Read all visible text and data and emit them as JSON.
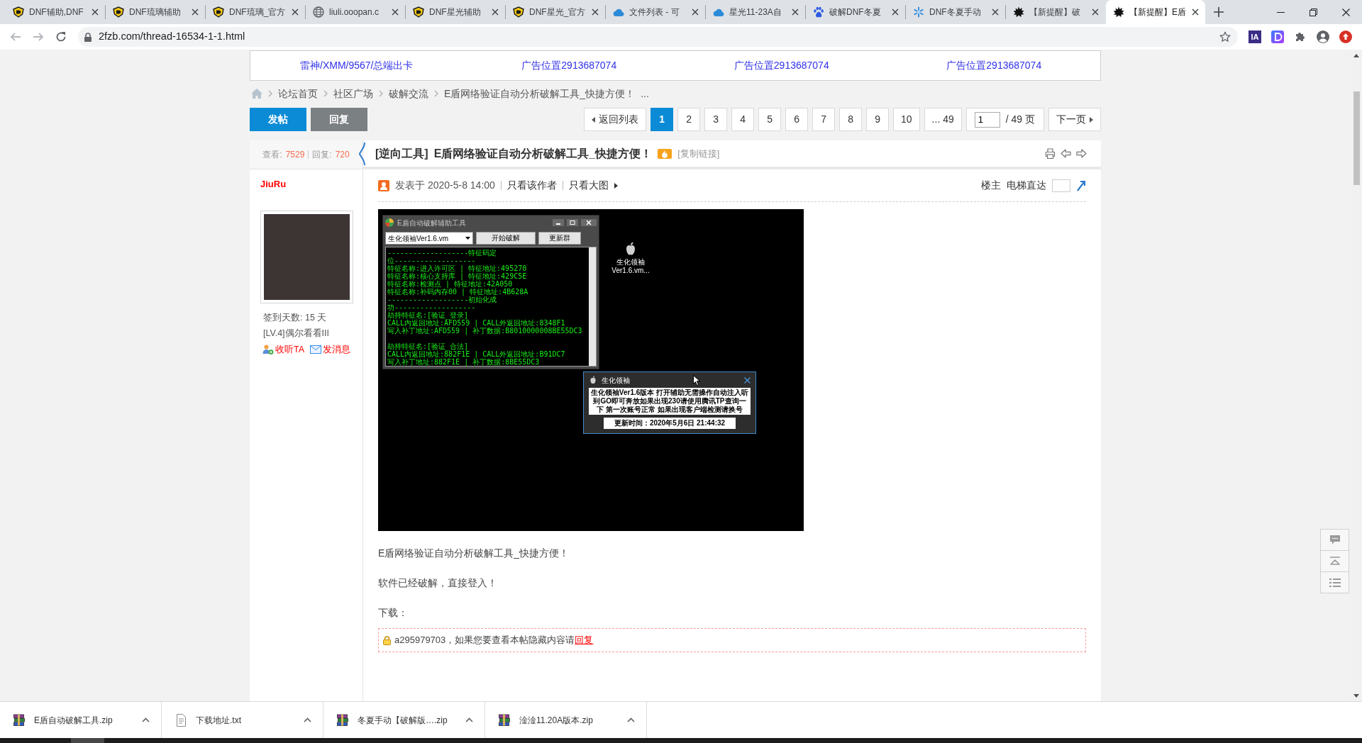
{
  "browser": {
    "tabs": [
      {
        "title": "DNF辅助,DNF",
        "kind": "crest",
        "selected": false
      },
      {
        "title": "DNF琉璃辅助",
        "kind": "crest",
        "selected": false
      },
      {
        "title": "DNF琉璃_官方",
        "kind": "crest",
        "selected": false
      },
      {
        "title": "liuli.ooopan.c",
        "kind": "globe",
        "selected": false
      },
      {
        "title": "DNF星光辅助",
        "kind": "crest",
        "selected": false
      },
      {
        "title": "DNF星光_官方",
        "kind": "crest",
        "selected": false
      },
      {
        "title": "文件列表 - 可",
        "kind": "cloud",
        "selected": false
      },
      {
        "title": "星光11-23A自",
        "kind": "cloud",
        "selected": false
      },
      {
        "title": "破解DNF冬夏",
        "kind": "paw",
        "selected": false
      },
      {
        "title": "DNF冬夏手动",
        "kind": "snowflake",
        "selected": false
      },
      {
        "title": "【新提醒】破",
        "kind": "splat",
        "selected": false
      },
      {
        "title": "【新提醒】E盾",
        "kind": "splat",
        "selected": true
      }
    ],
    "url": "2fzb.com/thread-16534-1-1.html",
    "extensions": [
      {
        "kind": "badge",
        "label": "IA"
      },
      {
        "kind": "tile"
      },
      {
        "kind": "puzzle"
      },
      {
        "kind": "account"
      },
      {
        "kind": "update"
      }
    ]
  },
  "forum": {
    "ad_links": [
      "雷神/XMM/9567/总端出卡",
      "广告位置2913687074",
      "广告位置2913687074",
      "广告位置2913687074"
    ],
    "breadcrumb": {
      "links": [
        "论坛首页",
        "社区广场",
        "破解交流",
        "E盾网络验证自动分析破解工具_快捷方便！"
      ],
      "more": "..."
    },
    "actions": [
      {
        "label": "发帖",
        "kind": "primary"
      },
      {
        "label": "回复",
        "kind": "secondary"
      }
    ],
    "pagination": {
      "back": "返回列表",
      "pages": [
        {
          "label": "1",
          "selected": true
        },
        {
          "label": "2",
          "selected": false
        },
        {
          "label": "3",
          "selected": false
        },
        {
          "label": "4",
          "selected": false
        },
        {
          "label": "5",
          "selected": false
        },
        {
          "label": "6",
          "selected": false
        },
        {
          "label": "7",
          "selected": false
        },
        {
          "label": "8",
          "selected": false
        },
        {
          "label": "9",
          "selected": false
        },
        {
          "label": "10",
          "selected": false
        },
        {
          "label": "... 49",
          "selected": false
        }
      ],
      "page_input": "1",
      "page_total": "/ 49 页",
      "next": "下一页"
    },
    "thread": {
      "views_label": "查看:",
      "views": "7529",
      "replies_label": "回复:",
      "replies": "720",
      "category": "[逆向工具]",
      "title": "E盾网络验证自动分析破解工具_快捷方便！",
      "copy_link": "[复制链接]"
    },
    "author": {
      "name": "JiuRu",
      "checkin": "签到天数: 15 天",
      "level": "[LV.4]偶尔看看III",
      "follow": "收听TA",
      "message": "发消息"
    },
    "post": {
      "posted": "发表于 2020-5-8 14:00",
      "author_only": "只看该作者",
      "large_images": "只看大图",
      "floor": "楼主",
      "jump": "电梯直达",
      "screenshot": {
        "tool_window": {
          "title": "E盾自动破解辅助工具",
          "combo": "生化领袖Ver1.6.vm",
          "buttons": [
            "开始破解",
            "更新群"
          ],
          "console": [
            [
              "-------------------特征码定",
              "位-------------------",
              "特征名称:进入许可区 | 特征地址:495270",
              "特征名称:核心支持库 | 特征地址:429C5E",
              "特征名称:检测点 | 特征地址:42A050",
              "特征名称:补码内存00 | 特征地址:4B628A",
              "-------------------初始化成",
              "功-------------------",
              "劫持特征名:[验证_登录]",
              "CALL内返回地址:AFD559 | CALL外返回地址:8348F1",
              "写入补丁地址:AFD559 | 补丁数据:B8010000008BE55DC3"
            ],
            [
              "劫持特征名:[验证_合法]",
              "CALL内返回地址:882F1E | CALL外返回地址:B91DC7",
              "写入补丁地址:882F1E | 补丁数据:8BE55DC3"
            ]
          ]
        },
        "desktop_icon": {
          "label": "生化领袖Ver1.6.vm..."
        },
        "popup": {
          "title": "生化领袖",
          "message": "生化领袖Ver1.6版本 打开辅助无需操作自动注入听到GO即可奔放如果出现230请使用腾讯TP查询一下 第一次账号正常 如果出现客户端检测请换号",
          "updated": "更新时间：2020年5月6日 21:44:32"
        }
      },
      "paragraphs": [
        "E盾网络验证自动分析破解工具_快捷方便！",
        "软件已经破解，直接登入！",
        "下载："
      ],
      "hidden": {
        "text": "a295979703，如果您要查看本帖隐藏内容请",
        "link": "回复"
      }
    }
  },
  "downloads": [
    {
      "name": "E盾自动破解工具.zip",
      "kind": "archive"
    },
    {
      "name": "下载地址.txt",
      "kind": "text"
    },
    {
      "name": "冬夏手动【破解版….zip",
      "kind": "archive"
    },
    {
      "name": "淦淦11.20A版本.zip",
      "kind": "archive"
    }
  ]
}
